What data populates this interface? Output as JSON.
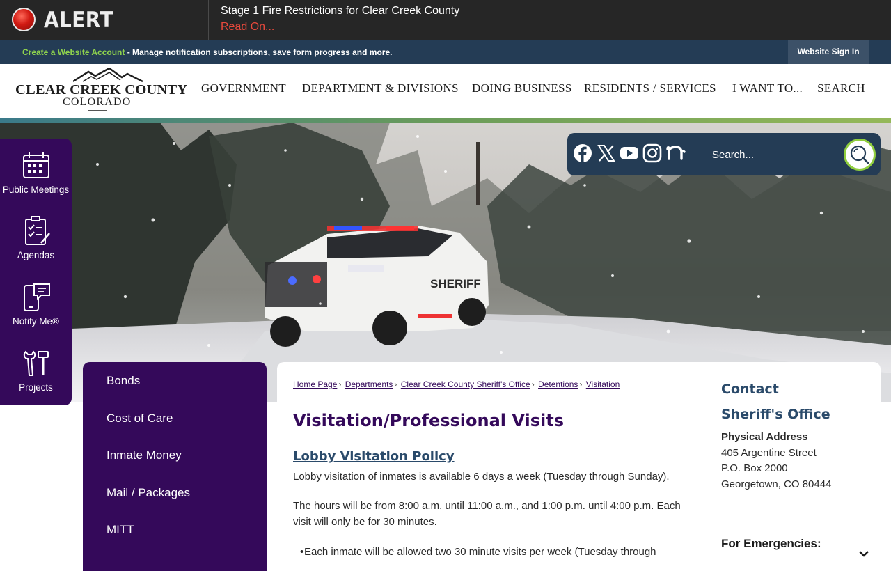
{
  "alert": {
    "badge_label": "ALERT",
    "title": "Stage 1 Fire Restrictions for Clear Creek County",
    "link": "Read On..."
  },
  "account": {
    "create_link": "Create a Website Account",
    "description": " - Manage notification subscriptions, save form progress and more.",
    "sign_in": "Website Sign In"
  },
  "header": {
    "logo_name": "CLEAR CREEK COUNTY",
    "logo_sub": "COLORADO",
    "nav": [
      "GOVERNMENT",
      "DEPARTMENT & DIVISIONS",
      "DOING BUSINESS",
      "RESIDENTS / SERVICES",
      "I WANT TO...",
      "SEARCH"
    ]
  },
  "quick_links": [
    {
      "label": "Public Meetings",
      "icon": "calendar-icon"
    },
    {
      "label": "Agendas",
      "icon": "checklist-icon"
    },
    {
      "label": "Notify Me®",
      "icon": "phone-chat-icon"
    },
    {
      "label": "Projects",
      "icon": "tools-icon"
    }
  ],
  "social": {
    "icons": [
      "facebook-icon",
      "x-icon",
      "youtube-icon",
      "instagram-icon",
      "nextdoor-icon"
    ],
    "search_placeholder": "Search..."
  },
  "subnav": [
    "Bonds",
    "Cost of Care",
    "Inmate Money",
    "Mail / Packages",
    "MITT"
  ],
  "breadcrumb": [
    "Home Page",
    "Departments",
    "Clear Creek County Sheriff's Office",
    "Detentions",
    "Visitation"
  ],
  "content": {
    "title": "Visitation/Professional Visits",
    "section_link": "Lobby Visitation Policy",
    "para1": "Lobby visitation of inmates is available 6 days a week (Tuesday through Sunday).",
    "para2": "The hours will be from 8:00 a.m. until 11:00 a.m., and 1:00 p.m. until 4:00 p.m. Each visit will only be for 30 minutes.",
    "bullet1": "Each inmate will be allowed two 30 minute visits per week (Tuesday through"
  },
  "contact": {
    "heading": "Contact",
    "office": "Sheriff's Office",
    "address_label": "Physical Address",
    "lines": [
      "405 Argentine Street",
      "P.O. Box 2000",
      "Georgetown, CO 80444"
    ],
    "emergencies": "For Emergencies:"
  },
  "colors": {
    "brand_purple": "#34095a",
    "navy": "#243c55",
    "alert_red": "#e8493c",
    "accent_green": "#8fd34d"
  }
}
